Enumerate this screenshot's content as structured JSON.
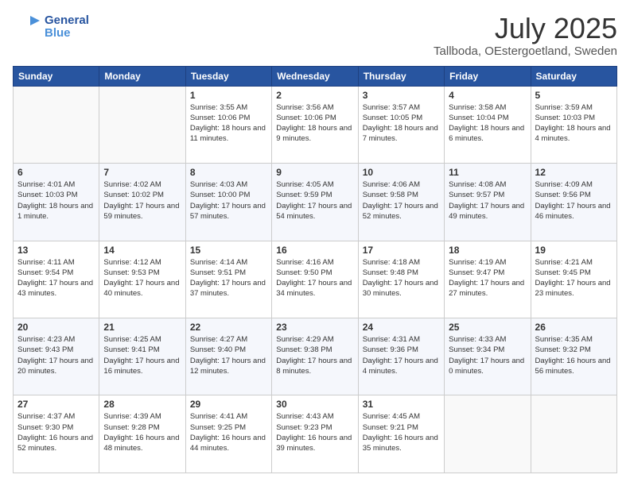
{
  "logo": {
    "text_general": "General",
    "text_blue": "Blue"
  },
  "header": {
    "month": "July 2025",
    "location": "Tallboda, OEstergoetland, Sweden"
  },
  "weekdays": [
    "Sunday",
    "Monday",
    "Tuesday",
    "Wednesday",
    "Thursday",
    "Friday",
    "Saturday"
  ],
  "weeks": [
    [
      {
        "day": "",
        "info": ""
      },
      {
        "day": "",
        "info": ""
      },
      {
        "day": "1",
        "info": "Sunrise: 3:55 AM\nSunset: 10:06 PM\nDaylight: 18 hours and 11 minutes."
      },
      {
        "day": "2",
        "info": "Sunrise: 3:56 AM\nSunset: 10:06 PM\nDaylight: 18 hours and 9 minutes."
      },
      {
        "day": "3",
        "info": "Sunrise: 3:57 AM\nSunset: 10:05 PM\nDaylight: 18 hours and 7 minutes."
      },
      {
        "day": "4",
        "info": "Sunrise: 3:58 AM\nSunset: 10:04 PM\nDaylight: 18 hours and 6 minutes."
      },
      {
        "day": "5",
        "info": "Sunrise: 3:59 AM\nSunset: 10:03 PM\nDaylight: 18 hours and 4 minutes."
      }
    ],
    [
      {
        "day": "6",
        "info": "Sunrise: 4:01 AM\nSunset: 10:03 PM\nDaylight: 18 hours and 1 minute."
      },
      {
        "day": "7",
        "info": "Sunrise: 4:02 AM\nSunset: 10:02 PM\nDaylight: 17 hours and 59 minutes."
      },
      {
        "day": "8",
        "info": "Sunrise: 4:03 AM\nSunset: 10:00 PM\nDaylight: 17 hours and 57 minutes."
      },
      {
        "day": "9",
        "info": "Sunrise: 4:05 AM\nSunset: 9:59 PM\nDaylight: 17 hours and 54 minutes."
      },
      {
        "day": "10",
        "info": "Sunrise: 4:06 AM\nSunset: 9:58 PM\nDaylight: 17 hours and 52 minutes."
      },
      {
        "day": "11",
        "info": "Sunrise: 4:08 AM\nSunset: 9:57 PM\nDaylight: 17 hours and 49 minutes."
      },
      {
        "day": "12",
        "info": "Sunrise: 4:09 AM\nSunset: 9:56 PM\nDaylight: 17 hours and 46 minutes."
      }
    ],
    [
      {
        "day": "13",
        "info": "Sunrise: 4:11 AM\nSunset: 9:54 PM\nDaylight: 17 hours and 43 minutes."
      },
      {
        "day": "14",
        "info": "Sunrise: 4:12 AM\nSunset: 9:53 PM\nDaylight: 17 hours and 40 minutes."
      },
      {
        "day": "15",
        "info": "Sunrise: 4:14 AM\nSunset: 9:51 PM\nDaylight: 17 hours and 37 minutes."
      },
      {
        "day": "16",
        "info": "Sunrise: 4:16 AM\nSunset: 9:50 PM\nDaylight: 17 hours and 34 minutes."
      },
      {
        "day": "17",
        "info": "Sunrise: 4:18 AM\nSunset: 9:48 PM\nDaylight: 17 hours and 30 minutes."
      },
      {
        "day": "18",
        "info": "Sunrise: 4:19 AM\nSunset: 9:47 PM\nDaylight: 17 hours and 27 minutes."
      },
      {
        "day": "19",
        "info": "Sunrise: 4:21 AM\nSunset: 9:45 PM\nDaylight: 17 hours and 23 minutes."
      }
    ],
    [
      {
        "day": "20",
        "info": "Sunrise: 4:23 AM\nSunset: 9:43 PM\nDaylight: 17 hours and 20 minutes."
      },
      {
        "day": "21",
        "info": "Sunrise: 4:25 AM\nSunset: 9:41 PM\nDaylight: 17 hours and 16 minutes."
      },
      {
        "day": "22",
        "info": "Sunrise: 4:27 AM\nSunset: 9:40 PM\nDaylight: 17 hours and 12 minutes."
      },
      {
        "day": "23",
        "info": "Sunrise: 4:29 AM\nSunset: 9:38 PM\nDaylight: 17 hours and 8 minutes."
      },
      {
        "day": "24",
        "info": "Sunrise: 4:31 AM\nSunset: 9:36 PM\nDaylight: 17 hours and 4 minutes."
      },
      {
        "day": "25",
        "info": "Sunrise: 4:33 AM\nSunset: 9:34 PM\nDaylight: 17 hours and 0 minutes."
      },
      {
        "day": "26",
        "info": "Sunrise: 4:35 AM\nSunset: 9:32 PM\nDaylight: 16 hours and 56 minutes."
      }
    ],
    [
      {
        "day": "27",
        "info": "Sunrise: 4:37 AM\nSunset: 9:30 PM\nDaylight: 16 hours and 52 minutes."
      },
      {
        "day": "28",
        "info": "Sunrise: 4:39 AM\nSunset: 9:28 PM\nDaylight: 16 hours and 48 minutes."
      },
      {
        "day": "29",
        "info": "Sunrise: 4:41 AM\nSunset: 9:25 PM\nDaylight: 16 hours and 44 minutes."
      },
      {
        "day": "30",
        "info": "Sunrise: 4:43 AM\nSunset: 9:23 PM\nDaylight: 16 hours and 39 minutes."
      },
      {
        "day": "31",
        "info": "Sunrise: 4:45 AM\nSunset: 9:21 PM\nDaylight: 16 hours and 35 minutes."
      },
      {
        "day": "",
        "info": ""
      },
      {
        "day": "",
        "info": ""
      }
    ]
  ]
}
